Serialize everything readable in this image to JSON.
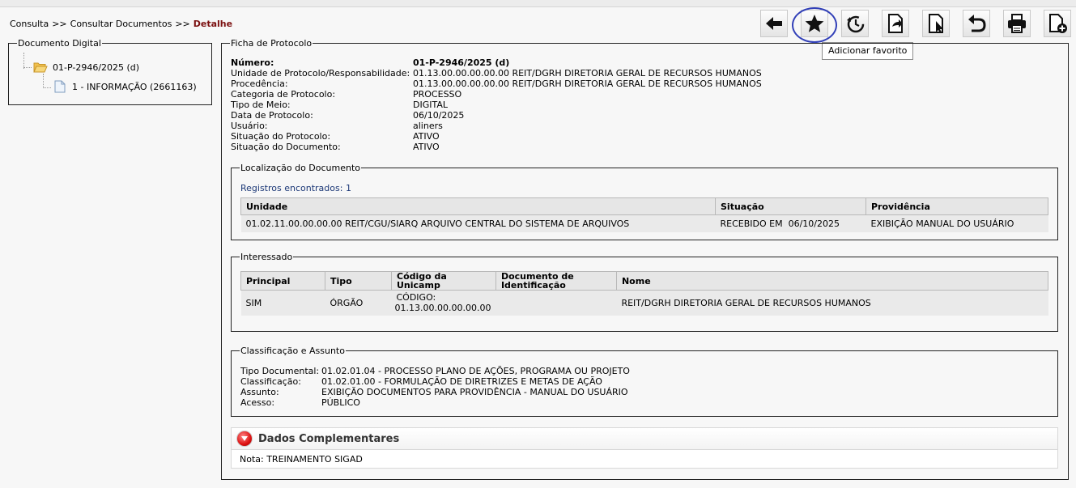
{
  "breadcrumb": {
    "items": [
      "Consulta",
      "Consultar Documentos"
    ],
    "separator": ">>",
    "current": "Detalhe"
  },
  "toolbar": {
    "buttons": [
      {
        "icon": "arrow-left-icon"
      },
      {
        "icon": "star-icon"
      },
      {
        "icon": "history-clock-icon"
      },
      {
        "icon": "document-forward-icon"
      },
      {
        "icon": "document-cursor-icon"
      },
      {
        "icon": "undo-icon"
      },
      {
        "icon": "printer-icon"
      },
      {
        "icon": "document-add-icon"
      }
    ],
    "tooltip": "Adicionar favorito"
  },
  "tree": {
    "legend": "Documento Digital",
    "root": "01-P-2946/2025 (d)",
    "child": "1 - INFORMAÇÃO (2661163)"
  },
  "ficha": {
    "legend": "Ficha de Protocolo",
    "rows": [
      {
        "label": "Número:",
        "value": "01-P-2946/2025 (d)"
      },
      {
        "label": "Unidade de Protocolo/Responsabilidade:",
        "value": "01.13.00.00.00.00.00 REIT/DGRH DIRETORIA GERAL DE RECURSOS HUMANOS"
      },
      {
        "label": "Procedência:",
        "value": "01.13.00.00.00.00.00 REIT/DGRH DIRETORIA GERAL DE RECURSOS HUMANOS"
      },
      {
        "label": "Categoria de Protocolo:",
        "value": "PROCESSO"
      },
      {
        "label": "Tipo de Meio:",
        "value": "DIGITAL"
      },
      {
        "label": "Data de Protocolo:",
        "value": "06/10/2025"
      },
      {
        "label": "Usuário:",
        "value": "aliners"
      },
      {
        "label": "Situação do Protocolo:",
        "value": "ATIVO"
      },
      {
        "label": "Situação do Documento:",
        "value": "ATIVO"
      }
    ]
  },
  "localizacao": {
    "legend": "Localização do Documento",
    "registros": "Registros encontrados: 1",
    "headers": [
      "Unidade",
      "Situação",
      "Providência"
    ],
    "rows": [
      [
        "01.02.11.00.00.00.00 REIT/CGU/SIARQ ARQUIVO CENTRAL DO SISTEMA DE ARQUIVOS",
        "RECEBIDO EM  06/10/2025",
        "EXIBIÇÃO MANUAL DO USUÁRIO"
      ]
    ]
  },
  "interessado": {
    "legend": "Interessado",
    "headers": [
      "Principal",
      "Tipo",
      "Código da Unicamp",
      "Documento de Identificação",
      "Nome"
    ],
    "rows": [
      {
        "principal": "SIM",
        "tipo": "ÓRGÃO",
        "codigo_label": "CÓDIGO:",
        "codigo": "01.13.00.00.00.00.00",
        "documento": "",
        "nome": "REIT/DGRH DIRETORIA GERAL DE RECURSOS HUMANOS"
      }
    ]
  },
  "classificacao": {
    "legend": "Classificação e Assunto",
    "rows": [
      {
        "label": "Tipo Documental:",
        "value": "01.02.01.04 - PROCESSO PLANO DE AÇÕES, PROGRAMA OU PROJETO"
      },
      {
        "label": "Classificação:",
        "value": "01.02.01.00 - FORMULAÇÃO DE DIRETRIZES E METAS DE AÇÃO"
      },
      {
        "label": "Assunto:",
        "value": "EXIBIÇÃO DOCUMENTOS PARA PROVIDÊNCIA - MANUAL DO USUÁRIO"
      },
      {
        "label": "Acesso:",
        "value": "PÚBLICO"
      }
    ]
  },
  "dados": {
    "title": "Dados Complementares",
    "nota": "Nota: TREINAMENTO SIGAD"
  }
}
